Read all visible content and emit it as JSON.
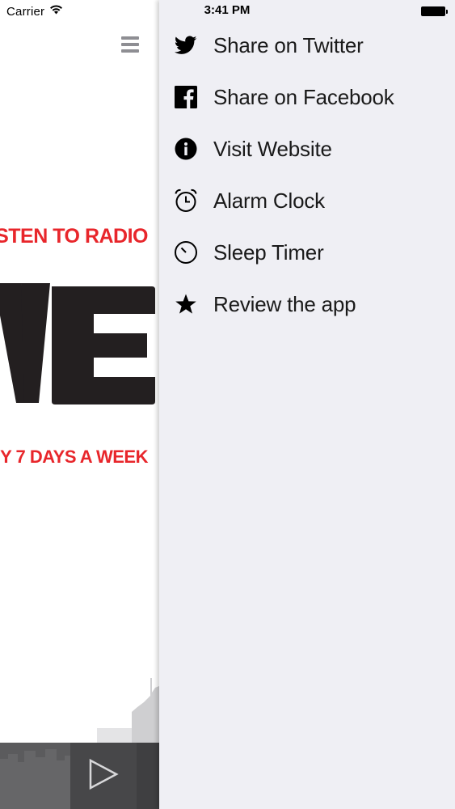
{
  "status_bar": {
    "carrier": "Carrier",
    "time": "3:41 PM"
  },
  "main": {
    "tagline_top": "STEN TO RADIO",
    "logo_text": "VE",
    "tagline_bottom": "Y 7 DAYS A WEEK",
    "accent_color": "#e8262b"
  },
  "player": {
    "play_icon": "play-icon"
  },
  "side_menu": {
    "items": [
      {
        "label": "Share on Twitter",
        "icon": "twitter-icon"
      },
      {
        "label": "Share on Facebook",
        "icon": "facebook-icon"
      },
      {
        "label": "Visit Website",
        "icon": "info-icon"
      },
      {
        "label": "Alarm Clock",
        "icon": "alarm-clock-icon"
      },
      {
        "label": "Sleep Timer",
        "icon": "timer-icon"
      },
      {
        "label": "Review the app",
        "icon": "star-icon"
      }
    ]
  }
}
